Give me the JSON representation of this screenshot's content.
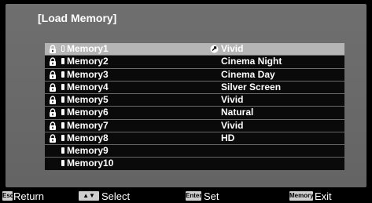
{
  "title": "[Load Memory]",
  "memories": [
    {
      "name": "Memory1",
      "mode": "Vivid",
      "locked": true,
      "selected": true,
      "has_mode_icon": true
    },
    {
      "name": "Memory2",
      "mode": "Cinema Night",
      "locked": true
    },
    {
      "name": "Memory3",
      "mode": "Cinema Day",
      "locked": true
    },
    {
      "name": "Memory4",
      "mode": "Silver Screen",
      "locked": true
    },
    {
      "name": "Memory5",
      "mode": "Vivid",
      "locked": true
    },
    {
      "name": "Memory6",
      "mode": "Natural",
      "locked": true
    },
    {
      "name": "Memory7",
      "mode": "Vivid",
      "locked": true
    },
    {
      "name": "Memory8",
      "mode": "HD",
      "locked": true
    },
    {
      "name": "Memory9",
      "mode": "",
      "locked": false
    },
    {
      "name": "Memory10",
      "mode": "",
      "locked": false
    }
  ],
  "footer": {
    "esc_key": "Esc",
    "return_label": "Return",
    "select_key": "▲▼",
    "select_label": "Select",
    "enter_key": "Enter",
    "set_label": "Set",
    "memory_key": "Memory",
    "exit_label": "Exit"
  },
  "colors": {
    "panel": "#6b6b6b",
    "row": "#0a0a0a",
    "selected_row": "#b5b5b5",
    "text": "#ffffff"
  }
}
